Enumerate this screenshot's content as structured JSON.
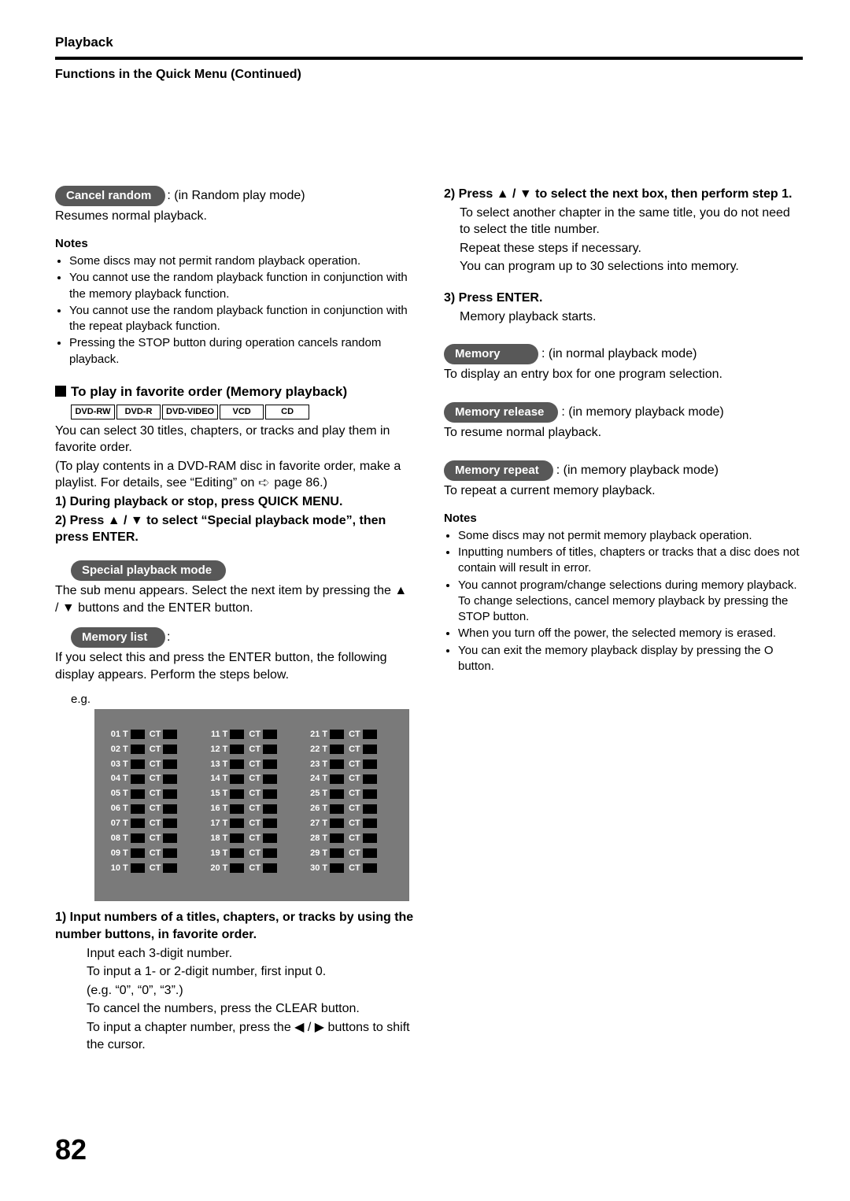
{
  "header": {
    "section": "Playback",
    "subheading": "Functions in the Quick Menu (Continued)"
  },
  "left": {
    "cancel_random": {
      "pill": "Cancel random",
      "suffix": ": (in Random play mode)",
      "line": "Resumes normal playback."
    },
    "notes_title": "Notes",
    "notes": [
      "Some discs may not permit random playback operation.",
      "You cannot use the random playback function in conjunction with the memory playback function.",
      "You cannot use the random playback function in conjunction with the repeat playback function.",
      "Pressing the STOP button during operation cancels random playback."
    ],
    "topic": "To play in favorite order (Memory playback)",
    "discs": [
      "DVD-RW",
      "DVD-R",
      "DVD-VIDEO",
      "VCD",
      "CD"
    ],
    "topic_p1": "You can select 30 titles, chapters, or tracks and play them in favorite order.",
    "topic_p2a": "(To play contents in a DVD-RAM disc in favorite order, make a playlist. For details, see “Editing” on ",
    "topic_p2b": " page 86.)",
    "step1": "1)  During playback or stop, press QUICK MENU.",
    "step2": "2)  Press ▲ / ▼ to select “Special playback mode”, then press ENTER.",
    "special_pill": "Special playback mode",
    "special_p": "The sub menu appears. Select the next item by pressing the ▲ / ▼ buttons and the ENTER button.",
    "memlist_pill": "Memory list",
    "memlist_colon": ":",
    "memlist_p": "If you select this and press the ENTER button, the following display appears. Perform the steps below.",
    "eg": "e.g.",
    "memory_rows": [
      [
        "01",
        "02",
        "03",
        "04",
        "05",
        "06",
        "07",
        "08",
        "09",
        "10"
      ],
      [
        "11",
        "12",
        "13",
        "14",
        "15",
        "16",
        "17",
        "18",
        "19",
        "20"
      ],
      [
        "21",
        "22",
        "23",
        "24",
        "25",
        "26",
        "27",
        "28",
        "29",
        "30"
      ]
    ],
    "step_mem1_bold": "1) Input numbers of a titles, chapters, or tracks by using the number buttons, in favorite order.",
    "step_mem1_lines": [
      "Input each 3-digit number.",
      "To input a 1- or 2-digit number, first input 0.",
      " (e.g. “0”, “0”, “3”.)",
      "To cancel the numbers, press the CLEAR button.",
      "To input a chapter number, press the ◀ / ▶ buttons to shift the cursor."
    ]
  },
  "right": {
    "step2_bold": "2) Press ▲ / ▼ to select the next box, then perform step 1.",
    "step2_lines": [
      "To select another chapter in the same title, you do not need to select the title number.",
      "Repeat these steps if necessary.",
      "You can program up to 30 selections into memory."
    ],
    "step3_bold": "3) Press ENTER.",
    "step3_line": "Memory playback starts.",
    "mem_pill": "Memory",
    "mem_suffix": ": (in normal playback mode)",
    "mem_line": "To display an entry box for one program selection.",
    "memrel_pill": "Memory release",
    "memrel_suffix": ": (in memory playback mode)",
    "memrel_line": "To resume normal playback.",
    "memrep_pill": "Memory repeat",
    "memrep_suffix": ": (in memory playback mode)",
    "memrep_line": "To repeat a current memory playback.",
    "notes_title": "Notes",
    "notes": [
      "Some discs may not permit memory playback operation.",
      "Inputting numbers of titles, chapters or tracks that a disc does not contain will result in error.",
      "You cannot program/change selections during memory playback. To change selections, cancel memory playback by pressing the STOP button.",
      "When you turn off the power, the selected memory is erased.",
      "You can exit the memory playback display by pressing the O button."
    ]
  },
  "page_number": "82"
}
